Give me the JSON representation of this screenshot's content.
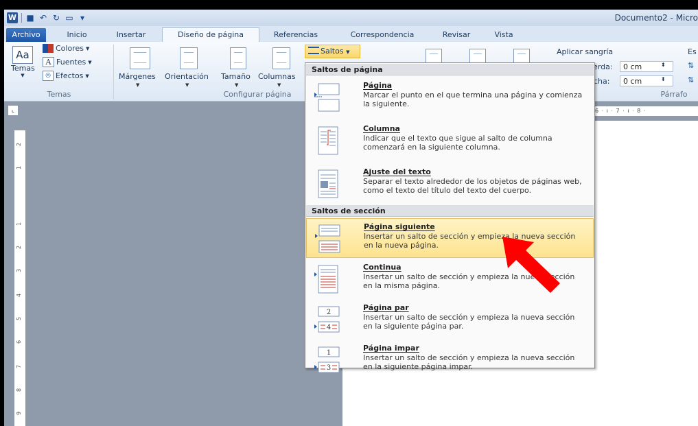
{
  "window": {
    "title": "Documento2 - Micro"
  },
  "tabs": {
    "file": "Archivo",
    "items": [
      "Inicio",
      "Insertar",
      "Diseño de página",
      "Referencias",
      "Correspondencia",
      "Revisar",
      "Vista"
    ]
  },
  "ribbon": {
    "temas": {
      "temas_label": "Temas",
      "colores": "Colores",
      "fuentes": "Fuentes",
      "efectos": "Efectos",
      "group": "Temas"
    },
    "config": {
      "margenes": "Márgenes",
      "orientacion": "Orientación",
      "tamano": "Tamaño",
      "columnas": "Columnas",
      "saltos": "Saltos",
      "group": "Configurar página"
    },
    "parrafo": {
      "sangria": "Aplicar sangría",
      "izquierda_label": "ierda:",
      "izquierda_value": "0 cm",
      "derecha_label": "cha:",
      "derecha_value": "0 cm",
      "group": "Párrafo",
      "es": "Es"
    }
  },
  "ruler": {
    "horizontal": "· ı · 6 · ı · 7 · ı · 8 ·",
    "vertical_marks": [
      "2",
      "1",
      "1",
      "2",
      "3",
      "4",
      "5",
      "6",
      "7",
      "8",
      "9"
    ]
  },
  "menu": {
    "section1": "Saltos de página",
    "section2": "Saltos de sección",
    "items": [
      {
        "title": "Página",
        "desc": "Marcar el punto en el que termina una página y comienza la siguiente."
      },
      {
        "title": "Columna",
        "desc": "Indicar que el texto que sigue al salto de columna comenzará en la siguiente columna."
      },
      {
        "title": "Ajuste del texto",
        "desc": "Separar el texto alrededor de los objetos de páginas web, como el texto del título del texto del cuerpo."
      },
      {
        "title": "Página siguiente",
        "desc": "Insertar un salto de sección y empieza la nueva sección en la nueva página."
      },
      {
        "title": "Continua",
        "desc": "Insertar un salto de sección y empieza la nueva sección en la misma página."
      },
      {
        "title": "Página par",
        "desc": "Insertar un salto de sección y empieza la nueva sección en la siguiente página par."
      },
      {
        "title": "Página impar",
        "desc": "Insertar un salto de sección y empieza la nueva sección en la siguiente página impar."
      }
    ],
    "icon_numbers": {
      "par_top": "2",
      "par_bottom": "4",
      "impar_top": "1",
      "impar_bottom": "3"
    }
  },
  "colors": {
    "highlight": "#fde38f",
    "accent_arrow": "#ff0000",
    "file_tab": "#2a5fb0"
  }
}
